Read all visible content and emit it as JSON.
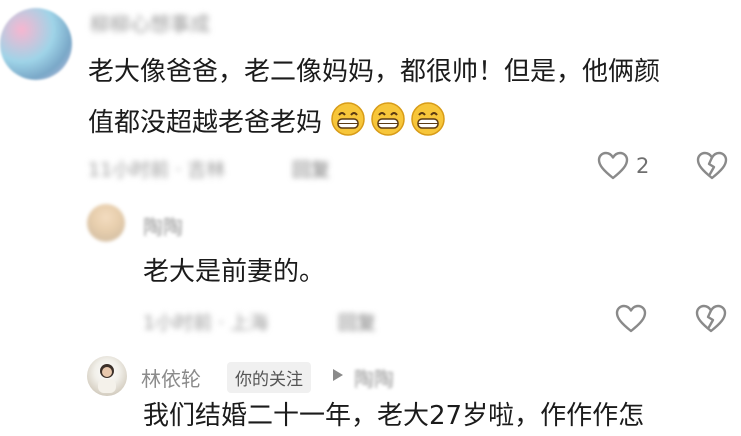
{
  "comment1": {
    "username": "柳柳心想事成",
    "text_line1": "老大像爸爸，老二像妈妈，都很帅！但是，他俩颜",
    "text_line2": "值都没超越老爸老妈",
    "emojis": [
      "grin-emoji",
      "grin-emoji",
      "grin-emoji"
    ],
    "time": "11小时前 · 吉林",
    "reply_label": "回复",
    "like_count": "2"
  },
  "reply1": {
    "username": "陶陶",
    "text": "老大是前妻的。",
    "time": "1小时前 · 上海",
    "reply_label": "回复"
  },
  "reply2": {
    "username": "林依轮",
    "following_tag": "你的关注",
    "reply_to": "陶陶",
    "text_partial": "我们结婚二十一年，老大27岁啦，作作作怎"
  },
  "colors": {
    "icon": "#8a8a8a",
    "text": "#1b1b1b",
    "meta": "#a0a0a0"
  }
}
